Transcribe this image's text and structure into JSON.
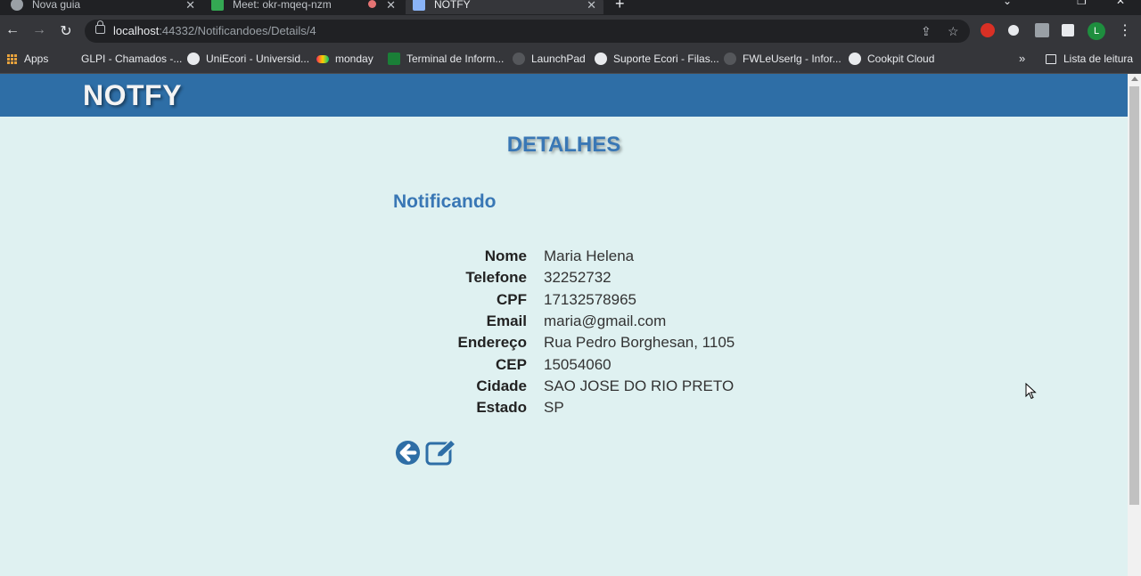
{
  "browser": {
    "tabs": [
      {
        "title": "Nova guia"
      },
      {
        "title": "Meet: okr-mqeq-nzm"
      },
      {
        "title": "NOTFY"
      }
    ],
    "address": {
      "host": "localhost",
      "path": ":44332/Notificandoes/Details/4"
    },
    "bookmarks": [
      {
        "label": "Apps"
      },
      {
        "label": "GLPI - Chamados -..."
      },
      {
        "label": "UniEcori - Universid..."
      },
      {
        "label": "monday"
      },
      {
        "label": "Terminal de Inform..."
      },
      {
        "label": "LaunchPad"
      },
      {
        "label": "Suporte Ecori - Filas..."
      },
      {
        "label": "FWLeUserlg - Infor..."
      },
      {
        "label": "Cookpit Cloud"
      }
    ],
    "reading_list": "Lista de leitura",
    "profile_initial": "L"
  },
  "app": {
    "brand": "NOTFY",
    "heading": "DETALHES",
    "subheading": "Notificando",
    "fields": [
      {
        "label": "Nome",
        "value": "Maria Helena"
      },
      {
        "label": "Telefone",
        "value": "32252732"
      },
      {
        "label": "CPF",
        "value": "17132578965"
      },
      {
        "label": "Email",
        "value": "maria@gmail.com"
      },
      {
        "label": "Endereço",
        "value": "Rua Pedro Borghesan, 1105"
      },
      {
        "label": "CEP",
        "value": "15054060"
      },
      {
        "label": "Cidade",
        "value": "SAO JOSE DO RIO PRETO"
      },
      {
        "label": "Estado",
        "value": "SP"
      }
    ],
    "actions": {
      "back_icon": "arrow-left-circle-icon",
      "edit_icon": "edit-icon"
    }
  },
  "colors": {
    "navbar": "#2e6ea6",
    "accent": "#3977b5",
    "background": "#dff1f1"
  }
}
